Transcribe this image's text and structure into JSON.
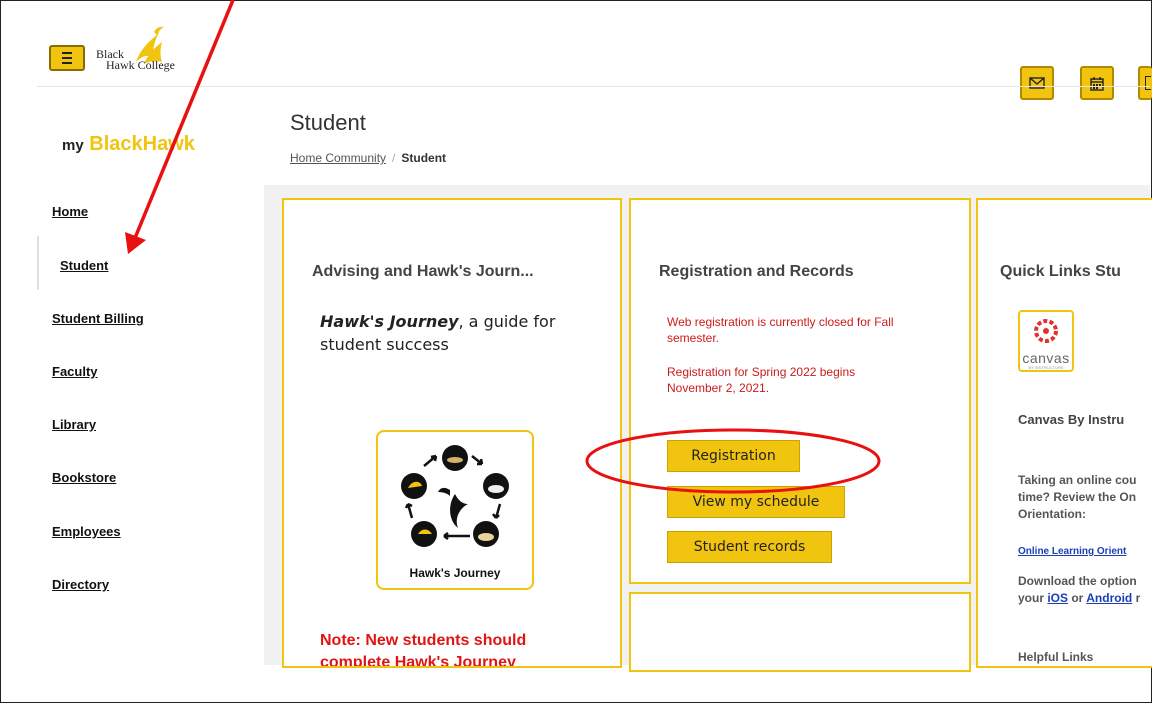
{
  "header": {
    "logo_line1": "Black",
    "logo_line2": "Hawk College"
  },
  "brand": {
    "prefix": "my",
    "name": "BlackHawk"
  },
  "sidebar": {
    "items": [
      {
        "label": "Home"
      },
      {
        "label": "Student"
      },
      {
        "label": "Student Billing"
      },
      {
        "label": "Faculty"
      },
      {
        "label": "Library"
      },
      {
        "label": "Bookstore"
      },
      {
        "label": "Employees"
      },
      {
        "label": "Directory"
      }
    ]
  },
  "page": {
    "title": "Student",
    "breadcrumb": {
      "home": "Home Community",
      "separator": "/",
      "current": "Student"
    }
  },
  "cards": {
    "advising": {
      "title": "Advising and Hawk's Journ...",
      "lead_bold": "Hawk's Journey",
      "lead_rest": ", a guide for student success",
      "image_caption": "Hawk's Journey",
      "note_line1": "Note: New students should",
      "note_line2": "complete Hawk's Journey"
    },
    "registration": {
      "title": "Registration and Records",
      "notice1": "Web registration is currently closed for Fall semester.",
      "notice2": "Registration for Spring 2022 begins November 2, 2021.",
      "buttons": {
        "registration": "Registration",
        "schedule": "View my schedule",
        "records": "Student records"
      }
    },
    "quicklinks": {
      "title": "Quick Links Stu",
      "canvas_word": "canvas",
      "canvas_sub": "BY INSTRUCTURE",
      "canvas_title": "Canvas By Instru",
      "online_line1": "Taking an online cou",
      "online_line2": "time? Review the On",
      "online_line3": "Orientation:",
      "online_link": "Online Learning Orient",
      "download_line1": "Download the option",
      "download_pre": "your ",
      "ios_link": "iOS",
      "or_text": " or ",
      "android_link": "Android",
      "download_post": " r",
      "helpful": "Helpful Links"
    }
  },
  "colors": {
    "accent": "#f1c40f",
    "annotation": "#e81010",
    "notice": "#cc1b1b"
  }
}
